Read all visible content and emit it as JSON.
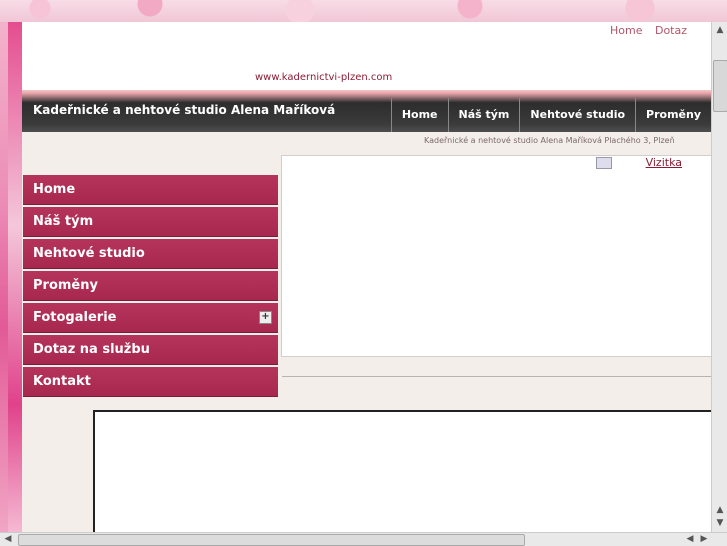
{
  "header": {
    "toplinks": [
      "Home",
      "Dotaz"
    ],
    "site_url": "www.kadernictvi-plzen.com"
  },
  "banner": {
    "title": "Kadeřnické a nehtové studio Alena Maříková",
    "nav": [
      "Home",
      "Náš tým",
      "Nehtové studio",
      "Proměny"
    ],
    "address": "Kadeřnické a nehtové studio Alena Maříková Plachého 3, Plzeň"
  },
  "sidebar": {
    "items": [
      {
        "label": "Home"
      },
      {
        "label": "Náš tým"
      },
      {
        "label": "Nehtové studio"
      },
      {
        "label": "Proměny"
      },
      {
        "label": "Fotogalerie"
      },
      {
        "label": "Dotaz na službu"
      },
      {
        "label": "Kontakt"
      }
    ]
  },
  "content": {
    "vizitka_label": "Vizitka"
  },
  "colors": {
    "menu_bg": "#b5345b",
    "banner_bg": "#2d2d2d",
    "link": "#8a1d35"
  },
  "icons": {
    "expand": "plus-icon",
    "vizitka": "card-icon"
  }
}
